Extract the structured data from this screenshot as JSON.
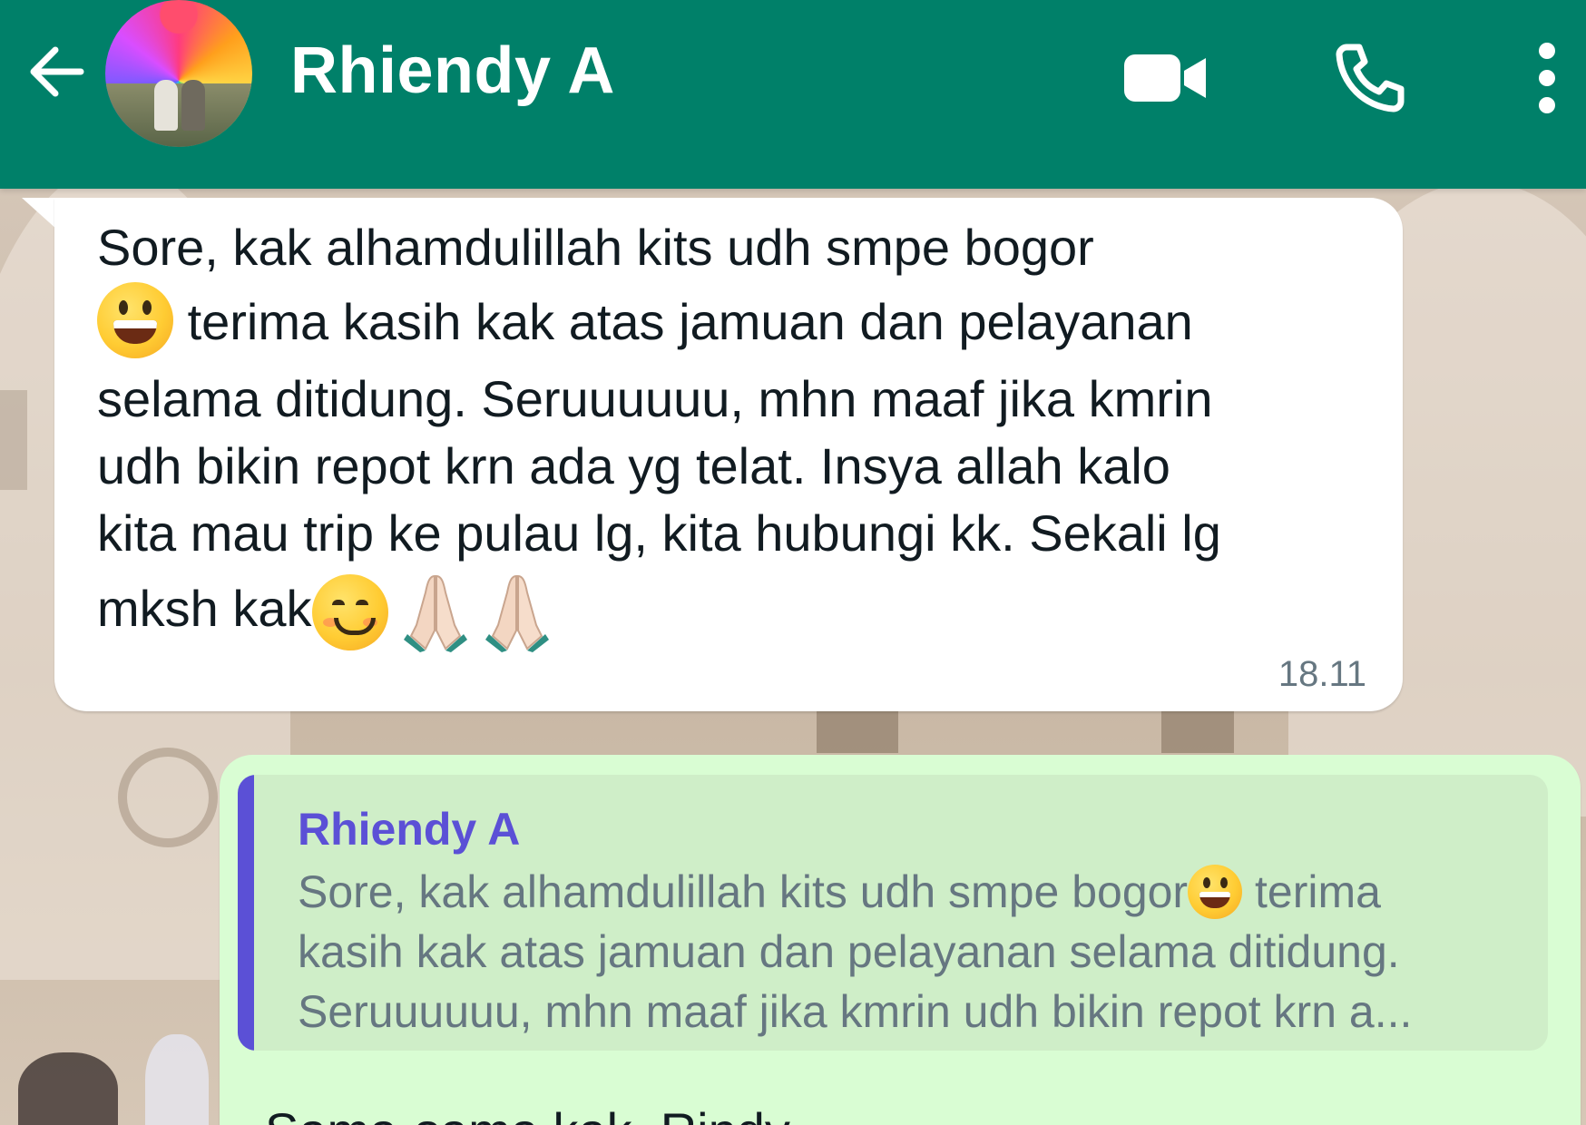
{
  "header": {
    "contact_name": "Rhiendy A",
    "back_icon": "arrow-left-icon",
    "video_call_icon": "videocam-icon",
    "voice_call_icon": "phone-icon",
    "menu_icon": "more-vert-icon",
    "background_color": "#008069"
  },
  "messages": {
    "incoming": {
      "lines": [
        "Sore, kak alhamdulillah kits udh smpe bogor",
        "terima kasih kak atas jamuan dan pelayanan",
        "selama ditidung. Seruuuuuu, mhn maaf jika kmrin",
        "udh bikin repot krn ada yg telat. Insya allah kalo",
        "kita mau trip ke pulau lg, kita hubungi kk. Sekali lg",
        "mksh kak"
      ],
      "time": "18.11",
      "emoji_icons": [
        "grinning-face-icon",
        "smiling-face-icon",
        "folded-hands-icon",
        "folded-hands-icon"
      ]
    },
    "outgoing": {
      "quote_author": "Rhiendy A",
      "quote_lines": [
        "Sore, kak alhamdulillah kits udh smpe bogor",
        "terima",
        "kasih kak atas jamuan dan pelayanan selama ditidung.",
        "Seruuuuuu, mhn maaf jika kmrin udh bikin repot krn a..."
      ],
      "reply_partial": "Sama-sama kak, Rindy",
      "bubble_color": "#d9fdd3",
      "quote_accent": "#5b50d6"
    }
  }
}
